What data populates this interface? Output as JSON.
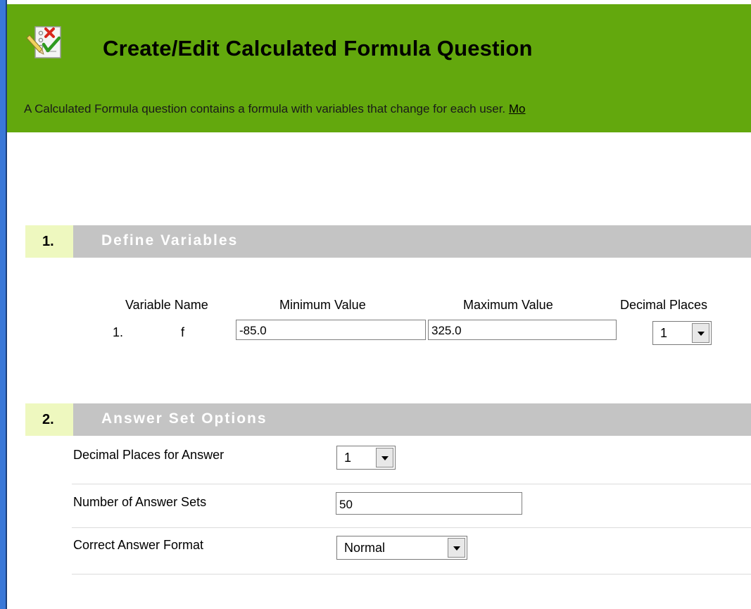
{
  "header": {
    "title": "Create/Edit Calculated Formula Question",
    "description": "A Calculated Formula question contains a formula with variables that change for each user. ",
    "more_link": "Mo",
    "logo_icon": "question-checklist-icon"
  },
  "section1": {
    "number": "1.",
    "title": "Define Variables",
    "columns": {
      "name": "Variable Name",
      "min": "Minimum Value",
      "max": "Maximum Value",
      "decimals": "Decimal Places"
    },
    "rows": [
      {
        "index": "1.",
        "name": "f",
        "min": "-85.0",
        "max": "325.0",
        "decimals": "1"
      }
    ]
  },
  "section2": {
    "number": "2.",
    "title": "Answer Set Options",
    "decimal_places_label": "Decimal Places for Answer",
    "decimal_places_value": "1",
    "num_sets_label": "Number of Answer Sets",
    "num_sets_value": "50",
    "format_label": "Correct Answer Format",
    "format_value": "Normal"
  },
  "colors": {
    "header_green": "#63a80d",
    "section_gray": "#c4c4c4",
    "section_number_bg": "#eef8bf",
    "frame_blue": "#2f6fcf"
  }
}
